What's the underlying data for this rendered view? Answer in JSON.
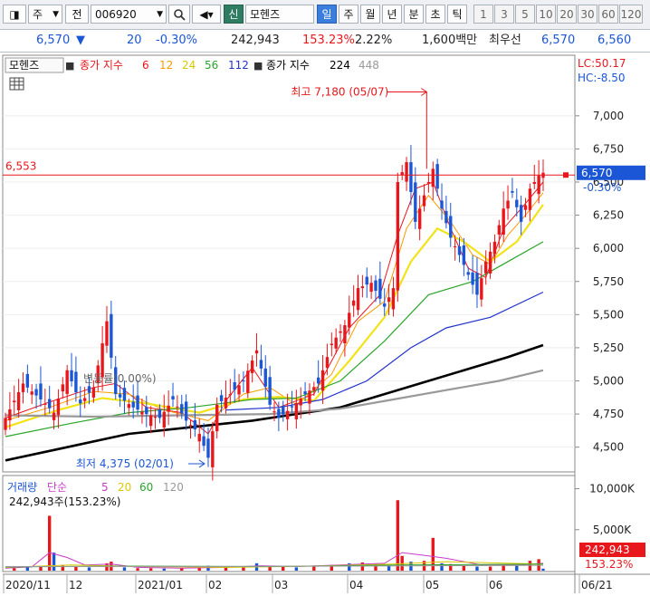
{
  "toolbar": {
    "market_label": "주",
    "jeon_label": "전",
    "code": "006920",
    "credit_badge": "신",
    "stock_name": "모헨즈",
    "period_tabs": [
      "일",
      "주",
      "월",
      "년",
      "분",
      "초",
      "틱"
    ],
    "active_period": "일",
    "interval_buttons": [
      "1",
      "3",
      "5",
      "10",
      "20",
      "30",
      "60",
      "120"
    ]
  },
  "quote": {
    "price": "6,570",
    "direction": "▼",
    "change": "20",
    "change_pct": "-0.30%",
    "volume": "242,943",
    "volume_ratio": "153.23%",
    "turnover": "2.22%",
    "amount": "1,600백만",
    "best_label": "최우선",
    "ask": "6,570",
    "bid": "6,560"
  },
  "colors": {
    "up": "#e8171c",
    "down": "#1b56d6",
    "ma6": "#e8171c",
    "ma12": "#ff9900",
    "ma24": "#f2e218",
    "ma56": "#2aa52a",
    "ma112": "#2233cc",
    "ma224": "#000000",
    "ma448": "#999999"
  },
  "chart_data": {
    "type": "candlestick",
    "title": "모헨즈",
    "ma_header_prefix": "종가 지수",
    "ma_header_prefix2": "종가 지수",
    "moving_averages": [
      {
        "name": "6",
        "color": "#e8171c"
      },
      {
        "name": "12",
        "color": "#ff9900"
      },
      {
        "name": "24",
        "color": "#d9c800"
      },
      {
        "name": "56",
        "color": "#2aa52a"
      },
      {
        "name": "112",
        "color": "#2233cc"
      },
      {
        "name": "224",
        "color": "#000000"
      },
      {
        "name": "448",
        "color": "#999999"
      }
    ],
    "limits": {
      "lc": "LC:50.17",
      "hc": "HC:-8.50"
    },
    "y_ticks": [
      7000,
      6750,
      6500,
      6250,
      6000,
      5750,
      5500,
      5250,
      5000,
      4750,
      4500
    ],
    "y_tick_labels": [
      "7,000",
      "6,750",
      "6,500",
      "6,250",
      "6,000",
      "5,750",
      "5,500",
      "5,250",
      "5,000",
      "4,750",
      "4,500"
    ],
    "ylim": [
      4320,
      7450
    ],
    "ref_line": {
      "value": 6553,
      "label": "6,553"
    },
    "current": {
      "value": 6570,
      "label": "6,570",
      "change_pct": "-0.30%"
    },
    "annotations": {
      "high": "최고 7,180 (05/07)",
      "low": "최저 4,375 (02/01)",
      "pivot_text": "변동률(0.00%)"
    },
    "x_labels": [
      "2020/11",
      "12",
      "2021/01",
      "02",
      "03",
      "04",
      "05",
      "06",
      "06/21"
    ],
    "price_points": [
      {
        "x": 0,
        "y": 4720
      },
      {
        "x": 4,
        "y": 4980
      },
      {
        "x": 8,
        "y": 4860
      },
      {
        "x": 11,
        "y": 4760
      },
      {
        "x": 14,
        "y": 5080
      },
      {
        "x": 17,
        "y": 4830
      },
      {
        "x": 20,
        "y": 4950
      },
      {
        "x": 23,
        "y": 5450
      },
      {
        "x": 25,
        "y": 4900
      },
      {
        "x": 29,
        "y": 4800
      },
      {
        "x": 32,
        "y": 4750
      },
      {
        "x": 35,
        "y": 4720
      },
      {
        "x": 38,
        "y": 4860
      },
      {
        "x": 41,
        "y": 4700
      },
      {
        "x": 44,
        "y": 4600
      },
      {
        "x": 46,
        "y": 4420
      },
      {
        "x": 48,
        "y": 4820
      },
      {
        "x": 51,
        "y": 4900
      },
      {
        "x": 54,
        "y": 5000
      },
      {
        "x": 57,
        "y": 5230
      },
      {
        "x": 60,
        "y": 4820
      },
      {
        "x": 62,
        "y": 4720
      },
      {
        "x": 65,
        "y": 4800
      },
      {
        "x": 68,
        "y": 4900
      },
      {
        "x": 71,
        "y": 4980
      },
      {
        "x": 74,
        "y": 5280
      },
      {
        "x": 77,
        "y": 5420
      },
      {
        "x": 80,
        "y": 5700
      },
      {
        "x": 83,
        "y": 5740
      },
      {
        "x": 86,
        "y": 5560
      },
      {
        "x": 88,
        "y": 5700
      },
      {
        "x": 89,
        "y": 6500
      },
      {
        "x": 91,
        "y": 6650
      },
      {
        "x": 93,
        "y": 6200
      },
      {
        "x": 95,
        "y": 6400
      },
      {
        "x": 97,
        "y": 6600
      },
      {
        "x": 99,
        "y": 6300
      },
      {
        "x": 101,
        "y": 6080
      },
      {
        "x": 103,
        "y": 5950
      },
      {
        "x": 105,
        "y": 5800
      },
      {
        "x": 107,
        "y": 5650
      },
      {
        "x": 109,
        "y": 5900
      },
      {
        "x": 111,
        "y": 6050
      },
      {
        "x": 113,
        "y": 6300
      },
      {
        "x": 115,
        "y": 6420
      },
      {
        "x": 117,
        "y": 6200
      },
      {
        "x": 119,
        "y": 6450
      },
      {
        "x": 121,
        "y": 6550
      },
      {
        "x": 122,
        "y": 6570
      }
    ],
    "ma_series": [
      {
        "name": "6",
        "points": [
          [
            0,
            4720
          ],
          [
            10,
            4840
          ],
          [
            20,
            4950
          ],
          [
            25,
            4980
          ],
          [
            32,
            4800
          ],
          [
            40,
            4760
          ],
          [
            46,
            4600
          ],
          [
            50,
            4850
          ],
          [
            56,
            5100
          ],
          [
            62,
            4800
          ],
          [
            70,
            4900
          ],
          [
            78,
            5400
          ],
          [
            85,
            5650
          ],
          [
            89,
            6100
          ],
          [
            93,
            6450
          ],
          [
            97,
            6500
          ],
          [
            101,
            6150
          ],
          [
            105,
            5850
          ],
          [
            109,
            5780
          ],
          [
            113,
            6150
          ],
          [
            117,
            6300
          ],
          [
            122,
            6500
          ]
        ]
      },
      {
        "name": "12",
        "points": [
          [
            0,
            4700
          ],
          [
            10,
            4800
          ],
          [
            20,
            4920
          ],
          [
            28,
            4900
          ],
          [
            36,
            4780
          ],
          [
            46,
            4700
          ],
          [
            54,
            4900
          ],
          [
            60,
            4950
          ],
          [
            66,
            4820
          ],
          [
            74,
            5050
          ],
          [
            80,
            5450
          ],
          [
            86,
            5600
          ],
          [
            91,
            6150
          ],
          [
            96,
            6400
          ],
          [
            101,
            6200
          ],
          [
            106,
            5950
          ],
          [
            110,
            5880
          ],
          [
            114,
            6100
          ],
          [
            118,
            6250
          ],
          [
            122,
            6420
          ]
        ]
      },
      {
        "name": "24",
        "points": [
          [
            0,
            4650
          ],
          [
            12,
            4780
          ],
          [
            22,
            4870
          ],
          [
            32,
            4830
          ],
          [
            44,
            4760
          ],
          [
            54,
            4860
          ],
          [
            62,
            4880
          ],
          [
            70,
            4850
          ],
          [
            78,
            5150
          ],
          [
            86,
            5480
          ],
          [
            92,
            5900
          ],
          [
            98,
            6150
          ],
          [
            104,
            6050
          ],
          [
            110,
            5900
          ],
          [
            116,
            6050
          ],
          [
            122,
            6330
          ]
        ]
      },
      {
        "name": "56",
        "points": [
          [
            0,
            4580
          ],
          [
            15,
            4680
          ],
          [
            28,
            4760
          ],
          [
            42,
            4800
          ],
          [
            56,
            4860
          ],
          [
            66,
            4870
          ],
          [
            76,
            5000
          ],
          [
            86,
            5300
          ],
          [
            96,
            5650
          ],
          [
            106,
            5750
          ],
          [
            114,
            5900
          ],
          [
            122,
            6050
          ]
        ]
      },
      {
        "name": "112",
        "points": [
          [
            50,
            4780
          ],
          [
            62,
            4800
          ],
          [
            72,
            4860
          ],
          [
            82,
            5000
          ],
          [
            92,
            5250
          ],
          [
            100,
            5400
          ],
          [
            110,
            5480
          ],
          [
            122,
            5670
          ]
        ]
      },
      {
        "name": "224",
        "points": [
          [
            0,
            4400
          ],
          [
            14,
            4500
          ],
          [
            28,
            4600
          ],
          [
            42,
            4650
          ],
          [
            56,
            4700
          ],
          [
            66,
            4750
          ],
          [
            76,
            4800
          ],
          [
            86,
            4900
          ],
          [
            96,
            5000
          ],
          [
            106,
            5100
          ],
          [
            114,
            5180
          ],
          [
            122,
            5270
          ]
        ]
      },
      {
        "name": "448",
        "points": [
          [
            0,
            4740
          ],
          [
            20,
            4730
          ],
          [
            40,
            4740
          ],
          [
            60,
            4750
          ],
          [
            76,
            4790
          ],
          [
            88,
            4860
          ],
          [
            100,
            4930
          ],
          [
            112,
            5000
          ],
          [
            122,
            5080
          ]
        ]
      }
    ],
    "volume": {
      "legend_label": "거래량",
      "legend_ma_prefix": "단순",
      "legend_mas": [
        {
          "name": "5",
          "color": "#c83cc8"
        },
        {
          "name": "20",
          "color": "#d9c800"
        },
        {
          "name": "60",
          "color": "#2aa52a"
        },
        {
          "name": "120",
          "color": "#999999"
        }
      ],
      "current_text": "242,943주(153.23%)",
      "y_tick_labels": [
        "10,000K",
        "5,000K"
      ],
      "y_ticks": [
        10000,
        5000
      ],
      "ylim": [
        0,
        11500
      ],
      "current_badge": "242,943",
      "current_pct": "153.23%",
      "bars": [
        {
          "x": 2,
          "v": 300
        },
        {
          "x": 5,
          "v": 400
        },
        {
          "x": 8,
          "v": 500
        },
        {
          "x": 10,
          "v": 6700
        },
        {
          "x": 11,
          "v": 2200
        },
        {
          "x": 13,
          "v": 700
        },
        {
          "x": 16,
          "v": 500
        },
        {
          "x": 19,
          "v": 400
        },
        {
          "x": 23,
          "v": 900
        },
        {
          "x": 24,
          "v": 1100
        },
        {
          "x": 27,
          "v": 400
        },
        {
          "x": 30,
          "v": 300
        },
        {
          "x": 33,
          "v": 300
        },
        {
          "x": 36,
          "v": 250
        },
        {
          "x": 40,
          "v": 300
        },
        {
          "x": 44,
          "v": 350
        },
        {
          "x": 46,
          "v": 600
        },
        {
          "x": 50,
          "v": 400
        },
        {
          "x": 54,
          "v": 500
        },
        {
          "x": 57,
          "v": 900
        },
        {
          "x": 60,
          "v": 600
        },
        {
          "x": 63,
          "v": 500
        },
        {
          "x": 66,
          "v": 400
        },
        {
          "x": 70,
          "v": 500
        },
        {
          "x": 74,
          "v": 700
        },
        {
          "x": 78,
          "v": 900
        },
        {
          "x": 81,
          "v": 1000
        },
        {
          "x": 84,
          "v": 800
        },
        {
          "x": 87,
          "v": 700
        },
        {
          "x": 89,
          "v": 8600
        },
        {
          "x": 90,
          "v": 1800
        },
        {
          "x": 92,
          "v": 1100
        },
        {
          "x": 95,
          "v": 1200
        },
        {
          "x": 97,
          "v": 4000
        },
        {
          "x": 99,
          "v": 900
        },
        {
          "x": 101,
          "v": 800
        },
        {
          "x": 104,
          "v": 600
        },
        {
          "x": 107,
          "v": 500
        },
        {
          "x": 110,
          "v": 500
        },
        {
          "x": 113,
          "v": 700
        },
        {
          "x": 116,
          "v": 600
        },
        {
          "x": 119,
          "v": 1200
        },
        {
          "x": 121,
          "v": 1400
        },
        {
          "x": 122,
          "v": 243
        }
      ],
      "ma5": [
        [
          0,
          300
        ],
        [
          6,
          450
        ],
        [
          10,
          2200
        ],
        [
          14,
          1600
        ],
        [
          18,
          700
        ],
        [
          24,
          800
        ],
        [
          30,
          400
        ],
        [
          40,
          300
        ],
        [
          50,
          400
        ],
        [
          58,
          600
        ],
        [
          66,
          500
        ],
        [
          76,
          700
        ],
        [
          86,
          900
        ],
        [
          90,
          2200
        ],
        [
          96,
          1800
        ],
        [
          100,
          1500
        ],
        [
          108,
          700
        ],
        [
          116,
          650
        ],
        [
          122,
          900
        ]
      ],
      "ma20": [
        [
          0,
          400
        ],
        [
          15,
          700
        ],
        [
          30,
          500
        ],
        [
          50,
          400
        ],
        [
          70,
          550
        ],
        [
          88,
          800
        ],
        [
          100,
          1100
        ],
        [
          122,
          800
        ]
      ],
      "ma60": [
        [
          0,
          450
        ],
        [
          30,
          550
        ],
        [
          60,
          500
        ],
        [
          90,
          700
        ],
        [
          122,
          800
        ]
      ],
      "ma120": [
        [
          0,
          500
        ],
        [
          60,
          520
        ],
        [
          122,
          650
        ]
      ]
    },
    "n_days": 123
  }
}
